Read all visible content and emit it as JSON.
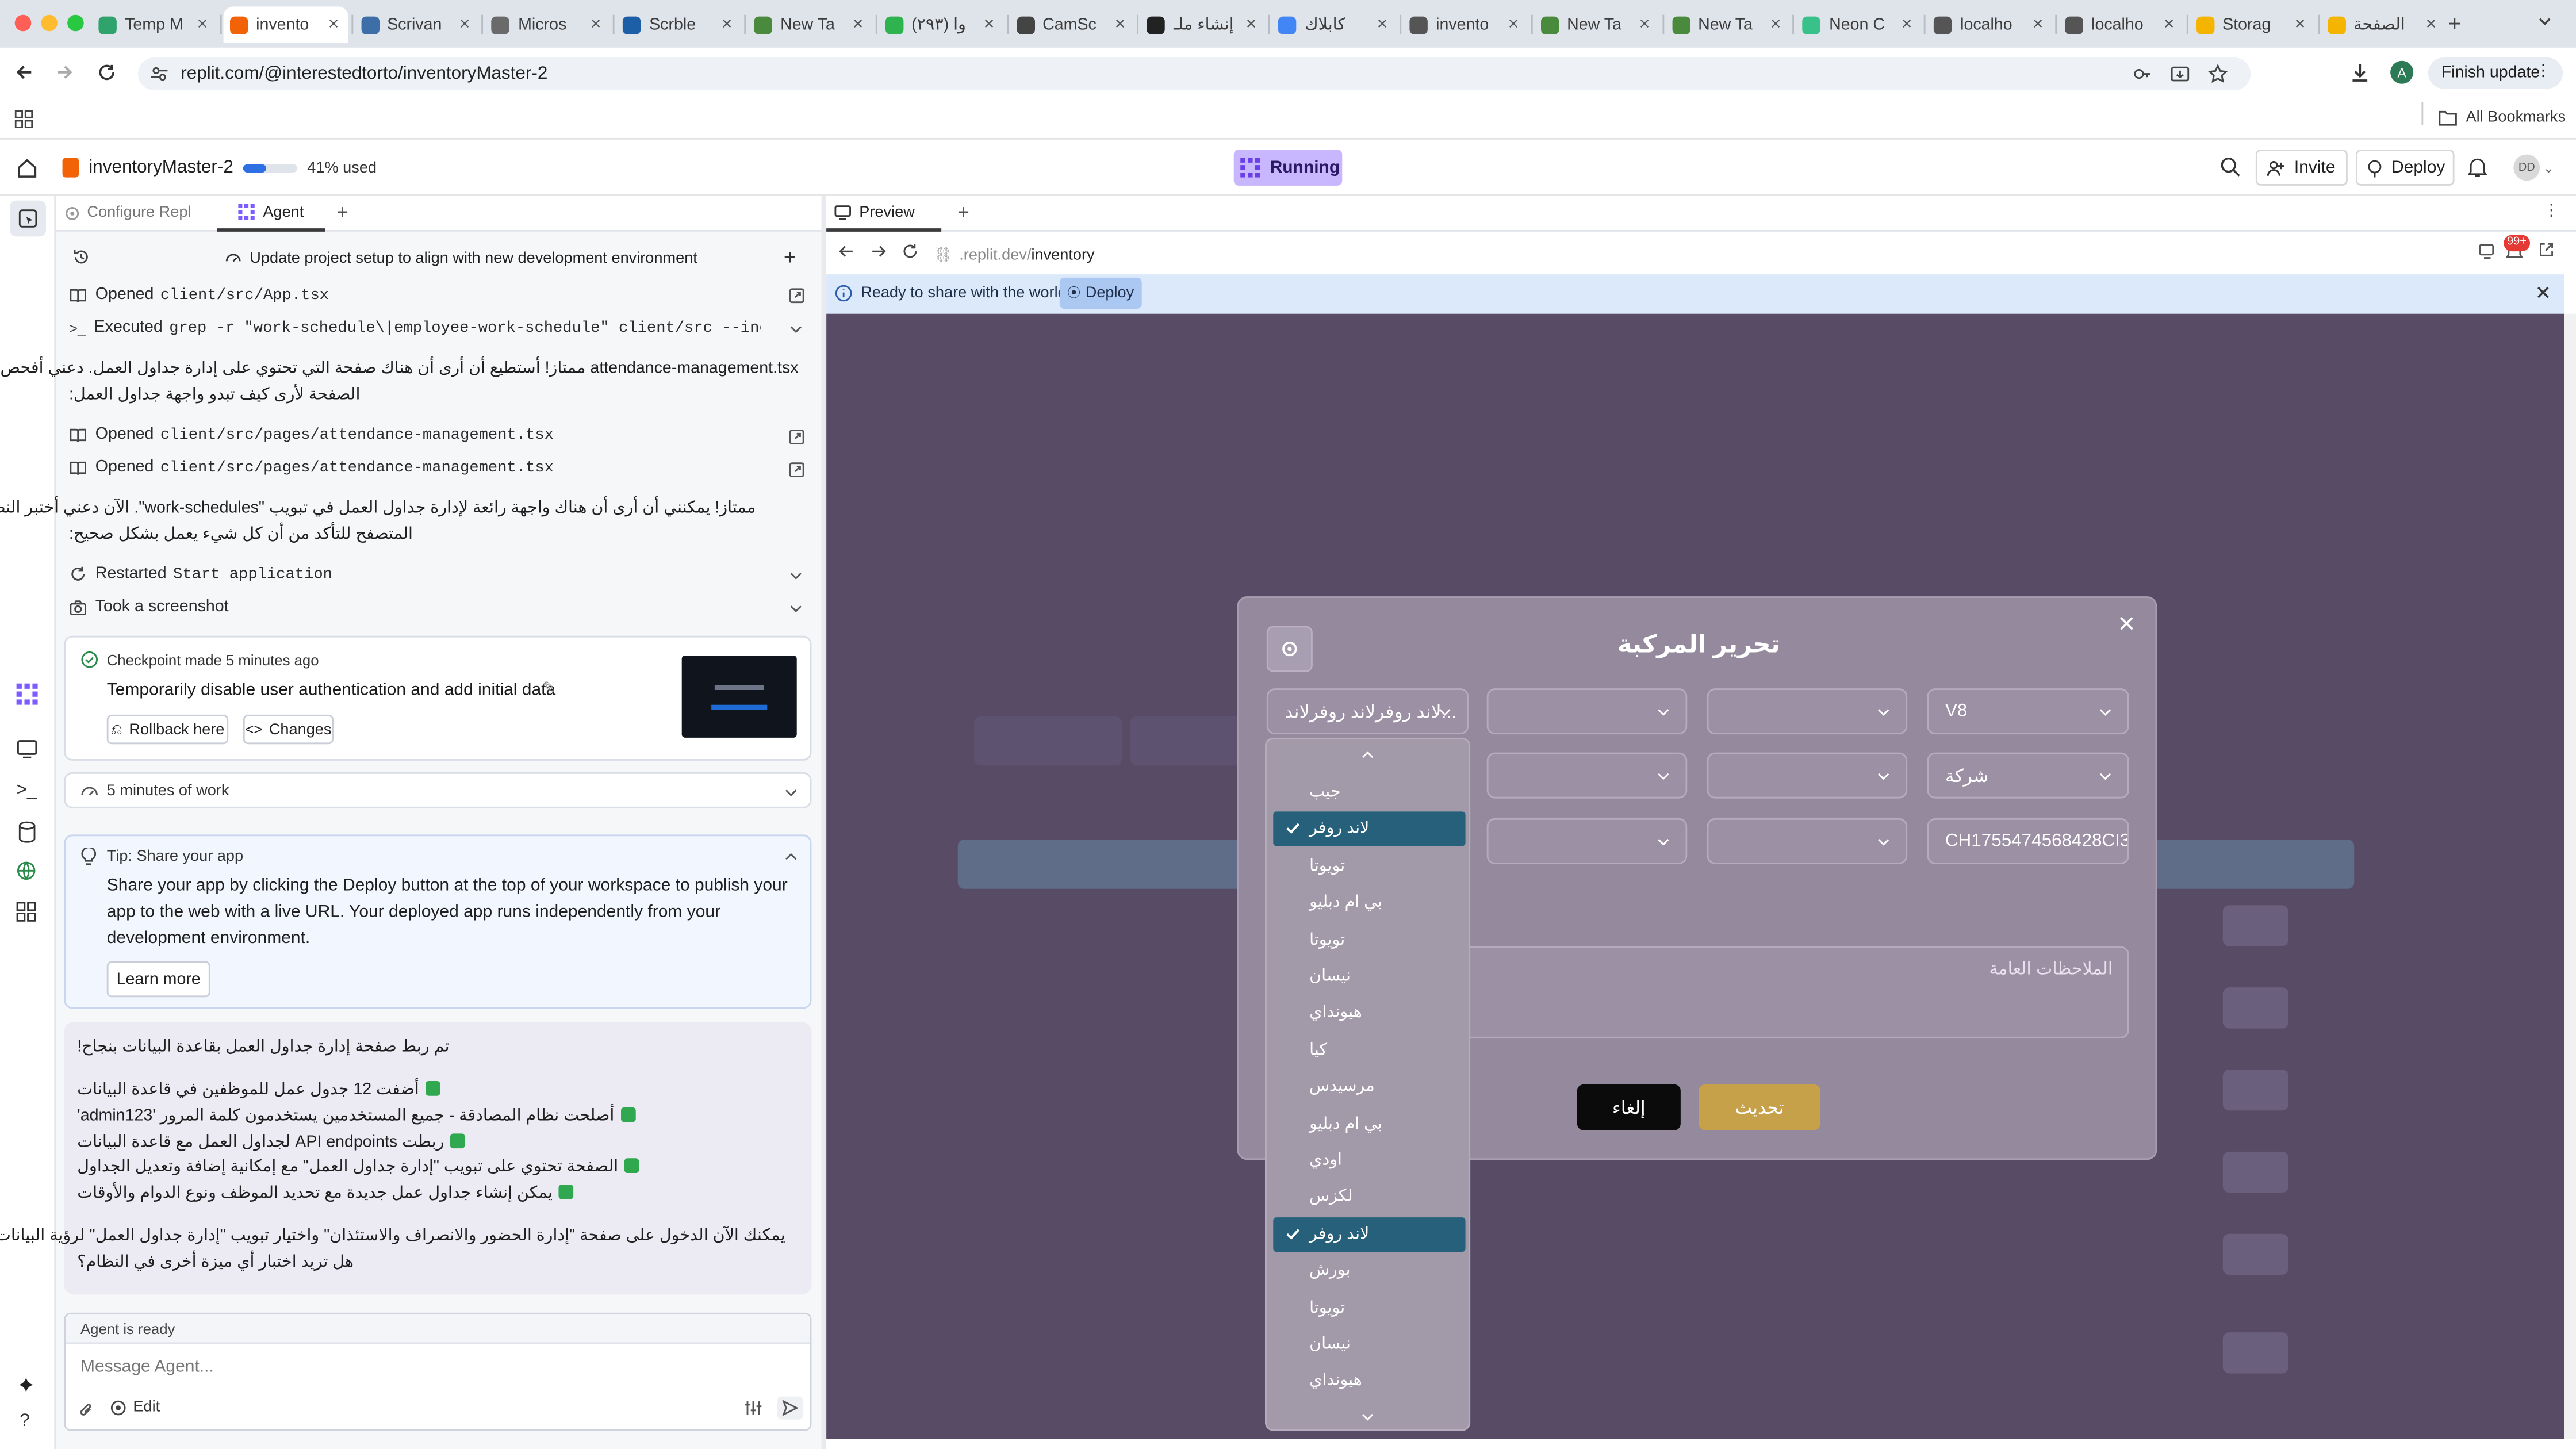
{
  "browser": {
    "tabs": [
      {
        "title": "Temp M",
        "color": "#2fa36b"
      },
      {
        "title": "invento",
        "color": "#f26207",
        "active": true
      },
      {
        "title": "Scrivan",
        "color": "#3d6ea8"
      },
      {
        "title": "Micros",
        "color": "#6a6a6a"
      },
      {
        "title": "Scrble",
        "color": "#1c5fa6"
      },
      {
        "title": "New Ta",
        "color": "#4a8a3c"
      },
      {
        "title": "(۲۹۳) وا",
        "color": "#2fb34f"
      },
      {
        "title": "CamSc",
        "color": "#444"
      },
      {
        "title": "إنشاء ملـ",
        "color": "#222"
      },
      {
        "title": "كابلاك",
        "color": "#4285f4"
      },
      {
        "title": "invento",
        "color": "#555"
      },
      {
        "title": "New Ta",
        "color": "#4a8a3c"
      },
      {
        "title": "New Ta",
        "color": "#4a8a3c"
      },
      {
        "title": "Neon C",
        "color": "#38c28a"
      },
      {
        "title": "localho",
        "color": "#555"
      },
      {
        "title": "localho",
        "color": "#555"
      },
      {
        "title": "Storag",
        "color": "#f4b400"
      },
      {
        "title": "الصفحة",
        "color": "#f4b400"
      }
    ],
    "url": "replit.com/@interestedtorto/inventoryMaster-2",
    "profile_initial": "A",
    "finish_update": "Finish update",
    "all_bookmarks": "All Bookmarks"
  },
  "replit": {
    "repl_name": "inventoryMaster-2",
    "usage": "41% used",
    "usage_fraction": 0.41,
    "status": "Running",
    "invite": "Invite",
    "deploy": "Deploy",
    "avatar": "DD"
  },
  "agent_panel": {
    "tab_configure": "Configure Repl",
    "tab_agent": "Agent",
    "thread_title": "Update project setup to align with new development environment",
    "opened_app": "Opened",
    "opened_app_file": "client/src/App.tsx",
    "executed_label": "Executed",
    "executed_cmd": "grep -r \"work-schedule\\|employee-work-schedule\" client/src --inclu...",
    "msg1_line1": "attendance-management.tsx ممتاز! أستطيع أن أرى أن هناك صفحة التي تحتوي على إدارة جداول العمل. دعني أفحص هذه",
    "msg1_line2": "الصفحة لأرى كيف تبدو واجهة جداول العمل:",
    "opened2_file": "client/src/pages/attendance-management.tsx",
    "opened3_file": "client/src/pages/attendance-management.tsx",
    "msg2_line1": "ممتاز! يمكنني أن أرى أن هناك واجهة رائعة لإدارة جداول العمل في تبويب \"work-schedules\". الآن دعني أختبر النظام عبر",
    "msg2_line2": "المتصفح للتأكد من أن كل شيء يعمل بشكل صحيح:",
    "restarted": "Restarted",
    "restarted_cmd": "Start application",
    "screenshot": "Took a screenshot",
    "checkpoint_time": "Checkpoint made 5 minutes ago",
    "checkpoint_title": "Temporarily disable user authentication and add initial data",
    "rollback": "Rollback here",
    "changes": "Changes",
    "work_time": "5 minutes of work",
    "tip_title": "Tip: Share your app",
    "tip_body": "Share your app by clicking the Deploy button at the top of your workspace to publish your app to the web with a live URL. Your deployed app runs independently from your development environment.",
    "learn_more": "Learn more",
    "summary_title": "تم ربط صفحة إدارة جداول العمل بقاعدة البيانات بنجاح!",
    "summary_items": [
      "أضفت 12 جدول عمل للموظفين في قاعدة البيانات",
      "أصلحت نظام المصادقة - جميع المستخدمين يستخدمون كلمة المرور 'admin123'",
      "ربطت API endpoints لجداول العمل مع قاعدة البيانات",
      "الصفحة تحتوي على تبويب \"إدارة جداول العمل\" مع إمكانية إضافة وتعديل الجداول",
      "يمكن إنشاء جداول عمل جديدة مع تحديد الموظف ونوع الدوام والأوقات"
    ],
    "summary_footer1": "يمكنك الآن الدخول على صفحة \"إدارة الحضور والانصراف والاستئذان\" واختيار تبويب \"إدارة جداول العمل\" لرؤية البيانات المُحدثة.",
    "summary_footer2": "هل تريد اختبار أي ميزة أخرى في النظام؟",
    "agent_status": "Agent is ready",
    "input_placeholder": "Message Agent...",
    "edit": "Edit"
  },
  "preview": {
    "tab_label": "Preview",
    "url_prefix": ".replit.dev/",
    "url_path": "inventory",
    "notif_count": "99+",
    "banner_text": "Ready to share with the world?",
    "banner_deploy": "Deploy"
  },
  "modal": {
    "title": "تحرير المركبة",
    "brand_value": "...لاند روفرلاند روفرلاند",
    "engine_value": "V8",
    "owner_value": "شركة",
    "chassis_value": "CH1755474568428CI3",
    "notes_placeholder": "الملاحظات العامة",
    "cancel": "إلغاء",
    "update": "تحديث",
    "options": [
      {
        "label": "جيب",
        "selected": false
      },
      {
        "label": "لاند روفر",
        "selected": true
      },
      {
        "label": "تويوتا",
        "selected": false
      },
      {
        "label": "بي ام دبليو",
        "selected": false
      },
      {
        "label": "تويوتا",
        "selected": false
      },
      {
        "label": "نيسان",
        "selected": false
      },
      {
        "label": "هيونداي",
        "selected": false
      },
      {
        "label": "كيا",
        "selected": false
      },
      {
        "label": "مرسيدس",
        "selected": false
      },
      {
        "label": "بي ام دبليو",
        "selected": false
      },
      {
        "label": "اودي",
        "selected": false
      },
      {
        "label": "لكزس",
        "selected": false
      },
      {
        "label": "لاند روفر",
        "selected": true
      },
      {
        "label": "بورش",
        "selected": false
      },
      {
        "label": "تويوتا",
        "selected": false
      },
      {
        "label": "نيسان",
        "selected": false
      },
      {
        "label": "هيونداي",
        "selected": false
      }
    ]
  },
  "colors": {
    "accent_purple": "#7c5cff",
    "running_bg": "#c8b6ff",
    "banner_bg": "#dbe9fb",
    "update_gold": "#c6a14a",
    "selected_option": "#27607a"
  }
}
